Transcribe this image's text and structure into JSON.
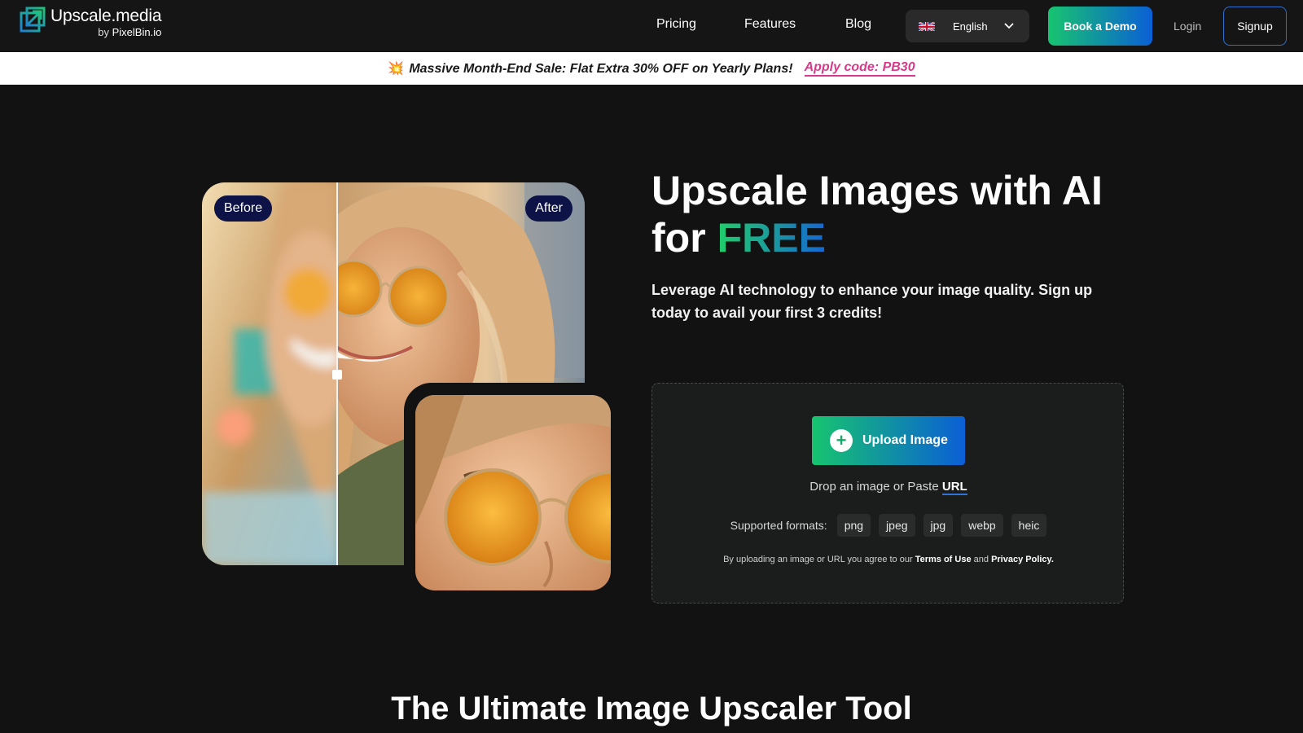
{
  "header": {
    "logo_title": "Upscale.media",
    "logo_by": "by",
    "logo_brand": "PixelBin.io",
    "nav": [
      "Pricing",
      "Features",
      "Blog"
    ],
    "language": "English",
    "book_demo": "Book a Demo",
    "login": "Login",
    "signup": "Signup"
  },
  "banner": {
    "emoji": "💥",
    "text": "Massive Month-End Sale: Flat Extra 30% OFF on Yearly Plans!",
    "code": "Apply code: PB30"
  },
  "hero": {
    "before_label": "Before",
    "after_label": "After",
    "title_line1": "Upscale Images with AI",
    "title_for": "for",
    "title_free": "FREE",
    "subtitle": "Leverage AI technology to enhance your image quality. Sign up today to avail your first 3 credits!"
  },
  "upload": {
    "button": "Upload Image",
    "drop_text": "Drop an image or Paste",
    "url_link": "URL",
    "formats_label": "Supported formats:",
    "formats": [
      "png",
      "jpeg",
      "jpg",
      "webp",
      "heic"
    ],
    "terms_prefix": "By uploading an image or URL you agree to our",
    "terms_link": "Terms of Use",
    "terms_and": "and",
    "privacy_link": "Privacy Policy."
  },
  "section_title": "The Ultimate Image Upscaler Tool",
  "colors": {
    "accent_green": "#17c46f",
    "accent_blue": "#0b5fd6",
    "promo_pink": "#d9398a",
    "background": "#121212"
  }
}
